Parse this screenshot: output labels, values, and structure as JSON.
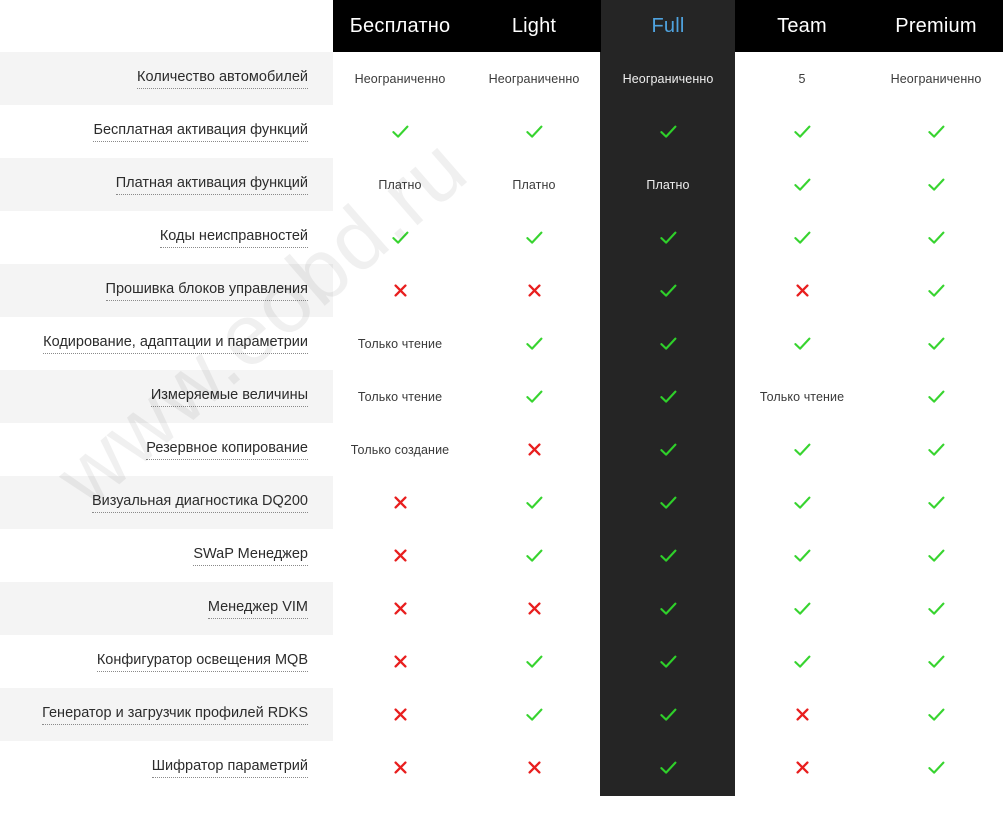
{
  "watermark": {
    "text": "www.eobd.ru"
  },
  "table": {
    "corner_label": "",
    "columns": [
      {
        "id": "free",
        "label": "Бесплатно",
        "highlight": false
      },
      {
        "id": "light",
        "label": "Light",
        "highlight": false
      },
      {
        "id": "full",
        "label": "Full",
        "highlight": true
      },
      {
        "id": "team",
        "label": "Team",
        "highlight": false
      },
      {
        "id": "premium",
        "label": "Premium",
        "highlight": false
      }
    ],
    "colors": {
      "header_bg": "#000000",
      "highlight_bg": "#252525",
      "highlight_text": "#4fa3df",
      "stripe_bg": "#f4f4f4",
      "check_green": "#38d430",
      "cross_red": "#e81e1e",
      "label_text": "#2c2c2c"
    },
    "rows": [
      {
        "label": "Количество автомобилей",
        "cells": [
          {
            "type": "text",
            "value": "Неограниченно"
          },
          {
            "type": "text",
            "value": "Неограниченно"
          },
          {
            "type": "text",
            "value": "Неограниченно"
          },
          {
            "type": "text",
            "value": "5"
          },
          {
            "type": "text",
            "value": "Неограниченно"
          }
        ]
      },
      {
        "label": "Бесплатная активация функций",
        "cells": [
          {
            "type": "check",
            "value": "check-icon"
          },
          {
            "type": "check",
            "value": "check-icon"
          },
          {
            "type": "check",
            "value": "check-icon"
          },
          {
            "type": "check",
            "value": "check-icon"
          },
          {
            "type": "check",
            "value": "check-icon"
          }
        ]
      },
      {
        "label": "Платная активация функций",
        "cells": [
          {
            "type": "text",
            "value": "Платно"
          },
          {
            "type": "text",
            "value": "Платно"
          },
          {
            "type": "text",
            "value": "Платно"
          },
          {
            "type": "check",
            "value": "check-icon"
          },
          {
            "type": "check",
            "value": "check-icon"
          }
        ]
      },
      {
        "label": "Коды неисправностей",
        "cells": [
          {
            "type": "check",
            "value": "check-icon"
          },
          {
            "type": "check",
            "value": "check-icon"
          },
          {
            "type": "check",
            "value": "check-icon"
          },
          {
            "type": "check",
            "value": "check-icon"
          },
          {
            "type": "check",
            "value": "check-icon"
          }
        ]
      },
      {
        "label": "Прошивка блоков управления",
        "cells": [
          {
            "type": "cross",
            "value": "cross-icon"
          },
          {
            "type": "cross",
            "value": "cross-icon"
          },
          {
            "type": "check",
            "value": "check-icon"
          },
          {
            "type": "cross",
            "value": "cross-icon"
          },
          {
            "type": "check",
            "value": "check-icon"
          }
        ]
      },
      {
        "label": "Кодирование, адаптации и параметрии",
        "cells": [
          {
            "type": "text",
            "value": "Только чтение"
          },
          {
            "type": "check",
            "value": "check-icon"
          },
          {
            "type": "check",
            "value": "check-icon"
          },
          {
            "type": "check",
            "value": "check-icon"
          },
          {
            "type": "check",
            "value": "check-icon"
          }
        ]
      },
      {
        "label": "Измеряемые величины",
        "cells": [
          {
            "type": "text",
            "value": "Только чтение"
          },
          {
            "type": "check",
            "value": "check-icon"
          },
          {
            "type": "check",
            "value": "check-icon"
          },
          {
            "type": "text",
            "value": "Только чтение"
          },
          {
            "type": "check",
            "value": "check-icon"
          }
        ]
      },
      {
        "label": "Резервное копирование",
        "cells": [
          {
            "type": "text",
            "value": "Только создание"
          },
          {
            "type": "cross",
            "value": "cross-icon"
          },
          {
            "type": "check",
            "value": "check-icon"
          },
          {
            "type": "check",
            "value": "check-icon"
          },
          {
            "type": "check",
            "value": "check-icon"
          }
        ]
      },
      {
        "label": "Визуальная диагностика DQ200",
        "cells": [
          {
            "type": "cross",
            "value": "cross-icon"
          },
          {
            "type": "check",
            "value": "check-icon"
          },
          {
            "type": "check",
            "value": "check-icon"
          },
          {
            "type": "check",
            "value": "check-icon"
          },
          {
            "type": "check",
            "value": "check-icon"
          }
        ]
      },
      {
        "label": "SWaP Менеджер",
        "cells": [
          {
            "type": "cross",
            "value": "cross-icon"
          },
          {
            "type": "check",
            "value": "check-icon"
          },
          {
            "type": "check",
            "value": "check-icon"
          },
          {
            "type": "check",
            "value": "check-icon"
          },
          {
            "type": "check",
            "value": "check-icon"
          }
        ]
      },
      {
        "label": "Менеджер VIM",
        "cells": [
          {
            "type": "cross",
            "value": "cross-icon"
          },
          {
            "type": "cross",
            "value": "cross-icon"
          },
          {
            "type": "check",
            "value": "check-icon"
          },
          {
            "type": "check",
            "value": "check-icon"
          },
          {
            "type": "check",
            "value": "check-icon"
          }
        ]
      },
      {
        "label": "Конфигуратор освещения MQB",
        "cells": [
          {
            "type": "cross",
            "value": "cross-icon"
          },
          {
            "type": "check",
            "value": "check-icon"
          },
          {
            "type": "check",
            "value": "check-icon"
          },
          {
            "type": "check",
            "value": "check-icon"
          },
          {
            "type": "check",
            "value": "check-icon"
          }
        ]
      },
      {
        "label": "Генератор и загрузчик профилей RDKS",
        "cells": [
          {
            "type": "cross",
            "value": "cross-icon"
          },
          {
            "type": "check",
            "value": "check-icon"
          },
          {
            "type": "check",
            "value": "check-icon"
          },
          {
            "type": "cross",
            "value": "cross-icon"
          },
          {
            "type": "check",
            "value": "check-icon"
          }
        ]
      },
      {
        "label": "Шифратор параметрий",
        "cells": [
          {
            "type": "cross",
            "value": "cross-icon"
          },
          {
            "type": "cross",
            "value": "cross-icon"
          },
          {
            "type": "check",
            "value": "check-icon"
          },
          {
            "type": "cross",
            "value": "cross-icon"
          },
          {
            "type": "check",
            "value": "check-icon"
          }
        ]
      }
    ]
  }
}
